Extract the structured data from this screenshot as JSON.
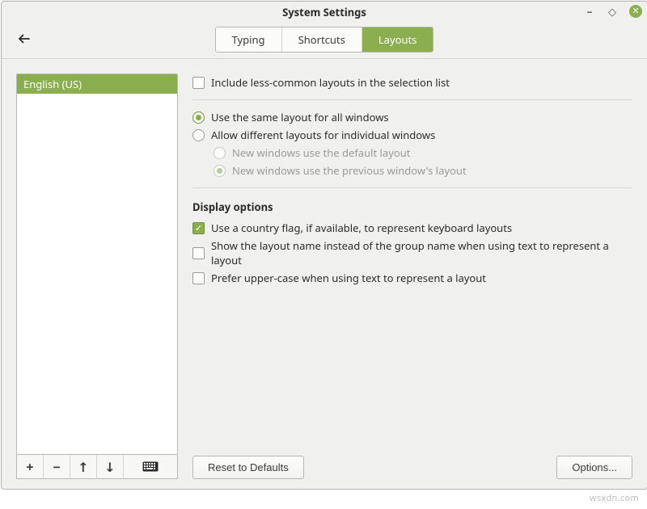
{
  "window": {
    "title": "System Settings"
  },
  "tabs": {
    "typing": "Typing",
    "shortcuts": "Shortcuts",
    "layouts": "Layouts",
    "active": "layouts"
  },
  "sidebar": {
    "items": [
      {
        "label": "English (US)",
        "selected": true
      }
    ]
  },
  "options": {
    "include_less_common": {
      "label": "Include less-common layouts in the selection list",
      "checked": false
    },
    "layout_scope": {
      "same_all": {
        "label": "Use the same layout for all windows",
        "selected": true
      },
      "per_window": {
        "label": "Allow different layouts for individual windows",
        "selected": false
      },
      "new_default": {
        "label": "New windows use the default layout",
        "selected": false,
        "enabled": false
      },
      "new_previous": {
        "label": "New windows use the previous window's layout",
        "selected": true,
        "enabled": false
      }
    },
    "display": {
      "title": "Display options",
      "use_flag": {
        "label": "Use a country flag, if available,  to represent keyboard layouts",
        "checked": true
      },
      "show_layout_name": {
        "label": "Show the layout name instead of the group name when using text to represent a layout",
        "checked": false
      },
      "prefer_uppercase": {
        "label": "Prefer upper-case when using text to represent a layout",
        "checked": false
      }
    }
  },
  "buttons": {
    "reset": "Reset to Defaults",
    "options": "Options..."
  },
  "toolbar": {
    "add": "+",
    "remove": "−",
    "up": "↑",
    "down": "↓"
  },
  "watermark": "wsxdn.com"
}
